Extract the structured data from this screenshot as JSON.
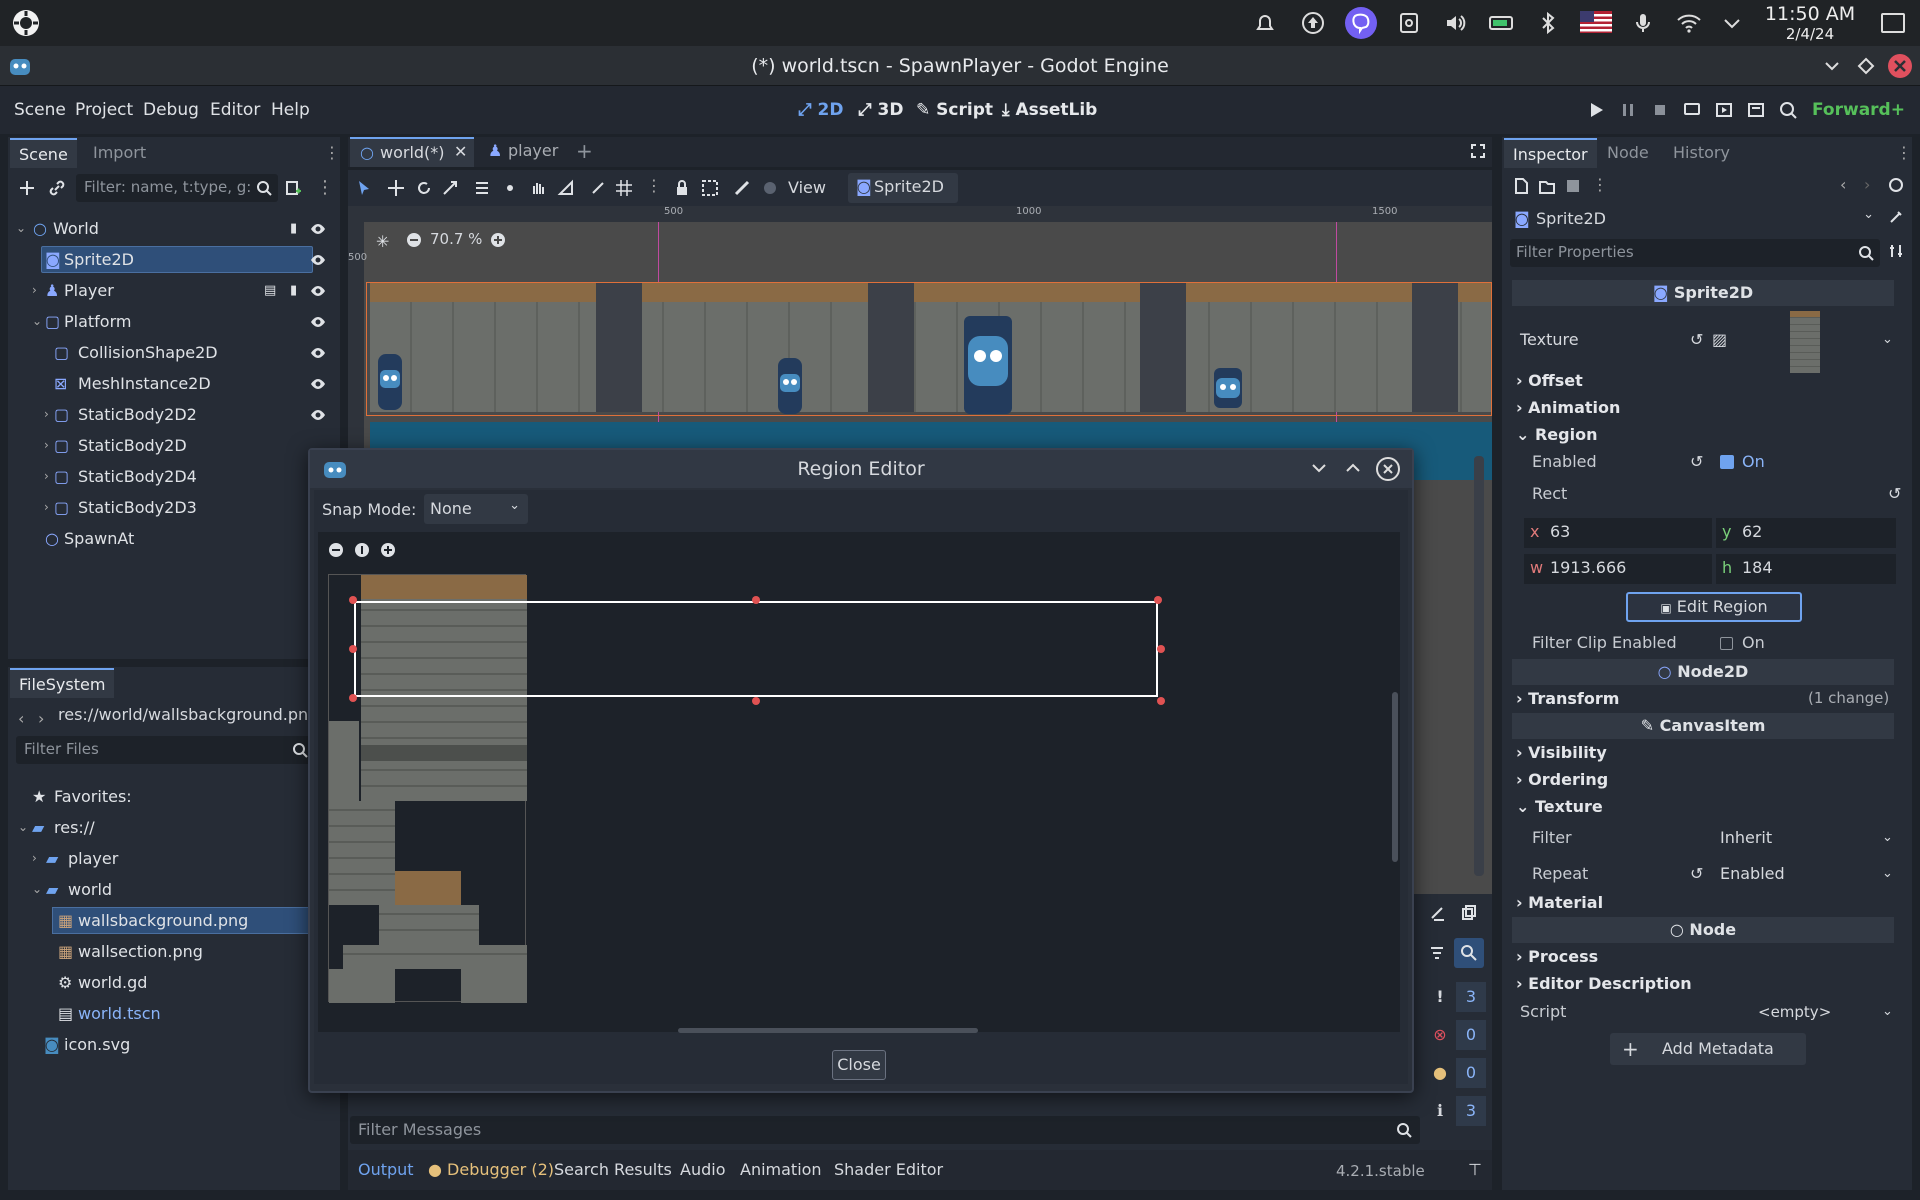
{
  "system": {
    "time": "11:50 AM",
    "date": "2/4/24"
  },
  "window": {
    "title": "(*) world.tscn - SpawnPlayer - Godot Engine"
  },
  "menu": {
    "items": [
      "Scene",
      "Project",
      "Debug",
      "Editor",
      "Help"
    ],
    "workspaces": [
      "2D",
      "3D",
      "Script",
      "AssetLib"
    ],
    "renderer": "Forward+"
  },
  "scene_dock": {
    "tabs": [
      "Scene",
      "Import"
    ],
    "filter_placeholder": "Filter: name, t:type, g:",
    "nodes": [
      "World",
      "Sprite2D",
      "Player",
      "Platform",
      "CollisionShape2D",
      "MeshInstance2D",
      "StaticBody2D2",
      "StaticBody2D",
      "StaticBody2D4",
      "StaticBody2D3",
      "SpawnAt"
    ]
  },
  "filesystem": {
    "tab": "FileSystem",
    "path": "res://world/wallsbackground.pn",
    "filter_placeholder": "Filter Files",
    "favorites": "Favorites:",
    "items": [
      "res://",
      "player",
      "world",
      "wallsbackground.png",
      "wallsection.png",
      "world.gd",
      "world.tscn",
      "icon.svg"
    ]
  },
  "editor_tabs": [
    "world(*)",
    "player"
  ],
  "toolbar": {
    "view": "View",
    "sprite": "Sprite2D",
    "zoom": "70.7 %"
  },
  "ruler": [
    "500",
    "1000",
    "1500"
  ],
  "ruler_v": "500",
  "region_editor": {
    "title": "Region Editor",
    "snap_label": "Snap Mode:",
    "snap_value": "None",
    "close_label": "Close"
  },
  "bottom": {
    "filter_placeholder": "Filter Messages",
    "tabs": [
      "Output",
      "Debugger (2)",
      "Search Results",
      "Audio",
      "Animation",
      "Shader Editor"
    ],
    "version": "4.2.1.stable",
    "counts": [
      "3",
      "0",
      "0",
      "3"
    ]
  },
  "inspector": {
    "tabs": [
      "Inspector",
      "Node",
      "History"
    ],
    "node": "Sprite2D",
    "filter_placeholder": "Filter Properties",
    "section_sprite": "Sprite2D",
    "texture_label": "Texture",
    "offset": "Offset",
    "animation": "Animation",
    "region": "Region",
    "enabled_label": "Enabled",
    "enabled_value": "On",
    "rect_label": "Rect",
    "rect": {
      "x": "63",
      "y": "62",
      "w": "1913.666",
      "h": "184"
    },
    "rect_keys": {
      "x": "x",
      "y": "y",
      "w": "w",
      "h": "h"
    },
    "edit_region": "Edit Region",
    "filter_clip_label": "Filter Clip Enabled",
    "filter_clip_value": "On",
    "section_node2d": "Node2D",
    "transform": "Transform",
    "transform_note": "(1 change)",
    "section_canvas": "CanvasItem",
    "visibility": "Visibility",
    "ordering": "Ordering",
    "texture_group": "Texture",
    "filter_label": "Filter",
    "filter_value": "Inherit",
    "repeat_label": "Repeat",
    "repeat_value": "Enabled",
    "material": "Material",
    "section_node": "Node",
    "process": "Process",
    "editor_desc": "Editor Description",
    "script_label": "Script",
    "script_value": "<empty>",
    "add_metadata": "Add Metadata"
  },
  "colors": {
    "accent": "#6fa3ef",
    "selection": "#2f4f79",
    "panel": "#262c36",
    "background": "#1d2229"
  }
}
